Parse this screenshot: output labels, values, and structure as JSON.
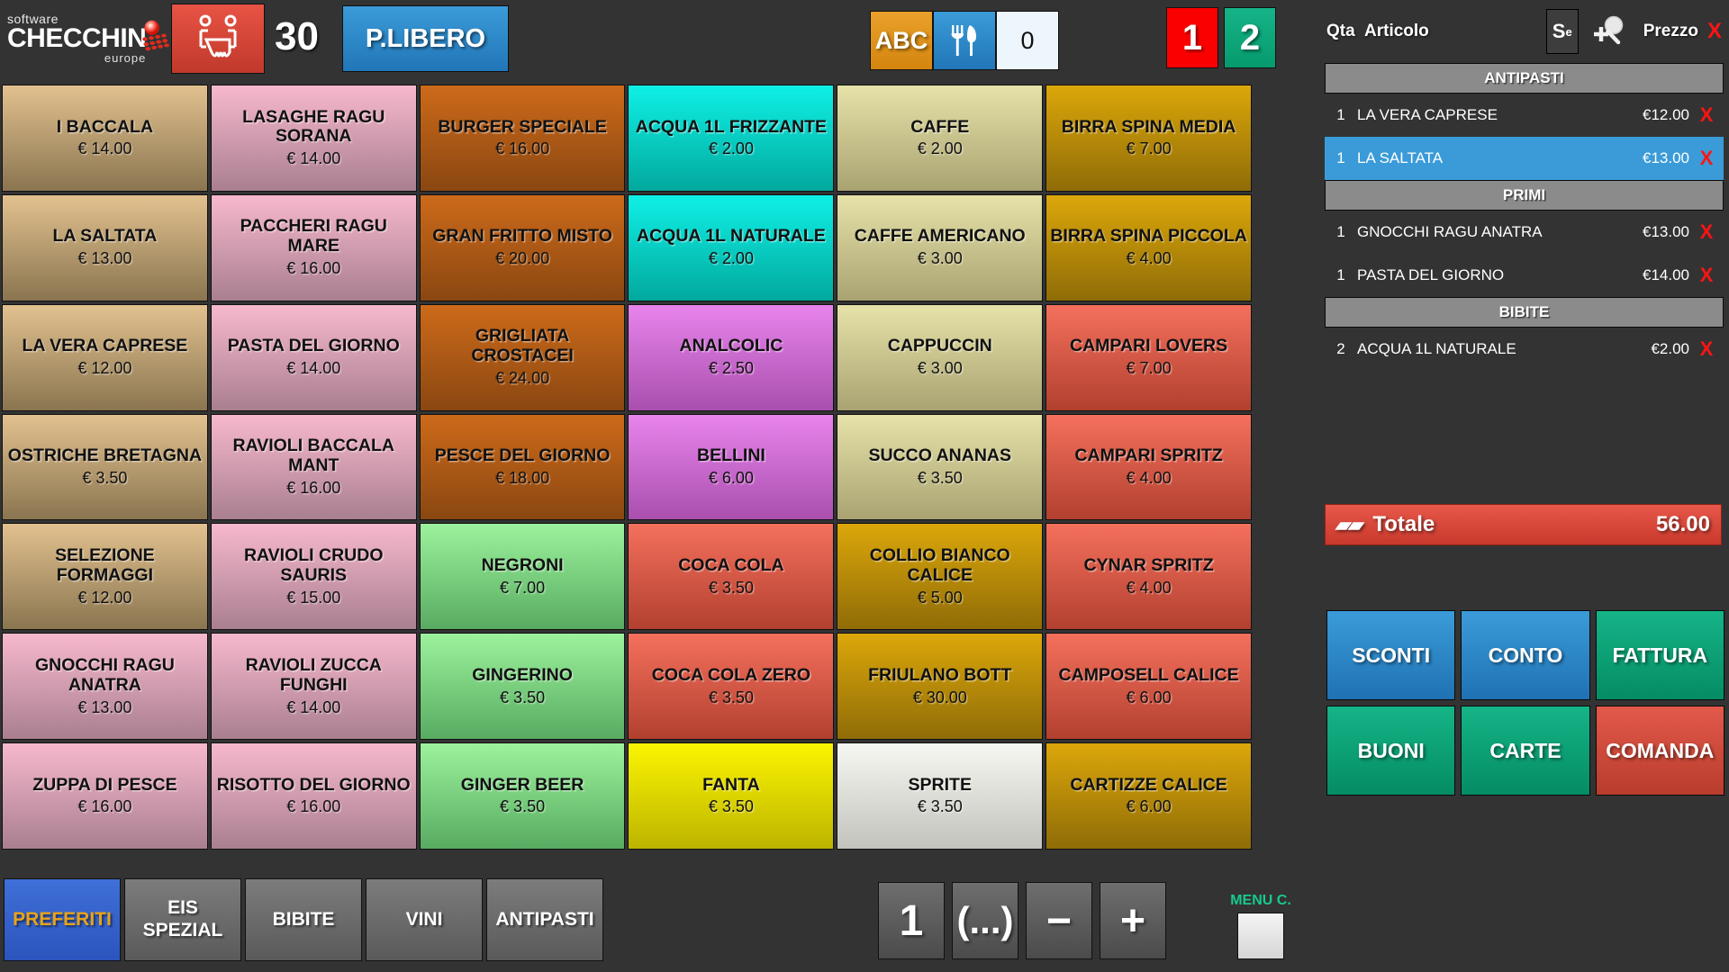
{
  "header": {
    "logo": {
      "software": "software",
      "brand": "CHECCHIN",
      "region": "europe",
      "icon": "checchin-logo-icon"
    },
    "table_icon": "table-seats-icon",
    "table_number": "30",
    "room_label": "P.LIBERO",
    "abc_label": "ABC",
    "cover_icon": "fork-knife-icon",
    "cover_count": "0",
    "qty_buttons": [
      {
        "label": "1",
        "color": "#fb0000"
      },
      {
        "label": "2",
        "color": "#069a6e"
      }
    ]
  },
  "grid": {
    "tiles": [
      {
        "name": "I BACCALA",
        "price": "€ 14.00",
        "c1": "#e2c18f",
        "c2": "#8a7550"
      },
      {
        "name": "LASAGHE RAGU SORANA",
        "price": "€ 14.00",
        "c1": "#f7b8cd",
        "c2": "#a97f90"
      },
      {
        "name": "BURGER SPECIALE",
        "price": "€ 16.00",
        "c1": "#cd6a1a",
        "c2": "#8a4711"
      },
      {
        "name": "ACQUA 1L FRIZZANTE",
        "price": "€ 2.00",
        "c1": "#0ff0e6",
        "c2": "#02a99d"
      },
      {
        "name": "CAFFE",
        "price": "€ 2.00",
        "c1": "#e6e2a8",
        "c2": "#a9a372"
      },
      {
        "name": "BIRRA SPINA MEDIA",
        "price": "€ 7.00",
        "c1": "#dca70a",
        "c2": "#8f6c07"
      },
      {
        "name": "LA SALTATA",
        "price": "€ 13.00",
        "c1": "#e2c18f",
        "c2": "#8a7550"
      },
      {
        "name": "PACCHERI RAGU MARE",
        "price": "€ 16.00",
        "c1": "#f7b8cd",
        "c2": "#a97f90"
      },
      {
        "name": "GRAN FRITTO MISTO",
        "price": "€ 20.00",
        "c1": "#cd6a1a",
        "c2": "#8a4711"
      },
      {
        "name": "ACQUA 1L NATURALE",
        "price": "€ 2.00",
        "c1": "#0ff0e6",
        "c2": "#02a99d"
      },
      {
        "name": "CAFFE AMERICANO",
        "price": "€ 3.00",
        "c1": "#e6e2a8",
        "c2": "#a9a372"
      },
      {
        "name": "BIRRA SPINA PICCOLA",
        "price": "€ 4.00",
        "c1": "#dca70a",
        "c2": "#8f6c07"
      },
      {
        "name": "LA VERA CAPRESE",
        "price": "€ 12.00",
        "c1": "#e2c18f",
        "c2": "#8a7550"
      },
      {
        "name": "PASTA DEL GIORNO",
        "price": "€ 14.00",
        "c1": "#f7b8cd",
        "c2": "#a97f90"
      },
      {
        "name": "GRIGLIATA CROSTACEI",
        "price": "€ 24.00",
        "c1": "#cd6a1a",
        "c2": "#8a4711"
      },
      {
        "name": "ANALCOLIC",
        "price": "€ 2.50",
        "c1": "#e884ec",
        "c2": "#a94fae"
      },
      {
        "name": "CAPPUCCIN",
        "price": "€ 3.00",
        "c1": "#e6e2a8",
        "c2": "#a9a372"
      },
      {
        "name": "CAMPARI LOVERS",
        "price": "€ 7.00",
        "c1": "#f4705c",
        "c2": "#b2402f"
      },
      {
        "name": "OSTRICHE BRETAGNA",
        "price": "€ 3.50",
        "c1": "#e2c18f",
        "c2": "#8a7550"
      },
      {
        "name": "RAVIOLI BACCALA MANT",
        "price": "€ 16.00",
        "c1": "#f7b8cd",
        "c2": "#a97f90"
      },
      {
        "name": "PESCE DEL GIORNO",
        "price": "€ 18.00",
        "c1": "#cd6a1a",
        "c2": "#8a4711"
      },
      {
        "name": "BELLINI",
        "price": "€ 6.00",
        "c1": "#e884ec",
        "c2": "#a94fae"
      },
      {
        "name": "SUCCO ANANAS",
        "price": "€ 3.50",
        "c1": "#e6e2a8",
        "c2": "#a9a372"
      },
      {
        "name": "CAMPARI SPRITZ",
        "price": "€ 4.00",
        "c1": "#f4705c",
        "c2": "#b2402f"
      },
      {
        "name": "SELEZIONE FORMAGGI",
        "price": "€ 12.00",
        "c1": "#e2c18f",
        "c2": "#8a7550"
      },
      {
        "name": "RAVIOLI CRUDO SAURIS",
        "price": "€ 15.00",
        "c1": "#f7b8cd",
        "c2": "#a97f90"
      },
      {
        "name": "NEGRONI",
        "price": "€ 7.00",
        "c1": "#9cf29c",
        "c2": "#58ab61"
      },
      {
        "name": "COCA COLA",
        "price": "€ 3.50",
        "c1": "#f4705c",
        "c2": "#b2402f"
      },
      {
        "name": "COLLIO BIANCO CALICE",
        "price": "€ 5.00",
        "c1": "#dca70a",
        "c2": "#8f6c07"
      },
      {
        "name": "CYNAR SPRITZ",
        "price": "€ 4.00",
        "c1": "#f4705c",
        "c2": "#b2402f"
      },
      {
        "name": "GNOCCHI RAGU ANATRA",
        "price": "€ 13.00",
        "c1": "#f7b8cd",
        "c2": "#a97f90"
      },
      {
        "name": "RAVIOLI ZUCCA FUNGHI",
        "price": "€ 14.00",
        "c1": "#f7b8cd",
        "c2": "#a97f90"
      },
      {
        "name": "GINGERINO",
        "price": "€ 3.50",
        "c1": "#9cf29c",
        "c2": "#58ab61"
      },
      {
        "name": "COCA COLA ZERO",
        "price": "€ 3.50",
        "c1": "#f4705c",
        "c2": "#b2402f"
      },
      {
        "name": "FRIULANO BOTT",
        "price": "€ 30.00",
        "c1": "#dca70a",
        "c2": "#8f6c07"
      },
      {
        "name": "CAMPOSELL CALICE",
        "price": "€ 6.00",
        "c1": "#f4705c",
        "c2": "#b2402f"
      },
      {
        "name": "ZUPPA DI PESCE",
        "price": "€ 16.00",
        "c1": "#f7b8cd",
        "c2": "#a97f90"
      },
      {
        "name": "RISOTTO DEL GIORNO",
        "price": "€ 16.00",
        "c1": "#f7b8cd",
        "c2": "#a97f90"
      },
      {
        "name": "GINGER BEER",
        "price": "€ 3.50",
        "c1": "#9cf29c",
        "c2": "#58ab61"
      },
      {
        "name": "FANTA",
        "price": "€ 3.50",
        "c1": "#fbf500",
        "c2": "#bdb400"
      },
      {
        "name": "SPRITE",
        "price": "€ 3.50",
        "c1": "#f7f7f2",
        "c2": "#c3c3bd"
      },
      {
        "name": "CARTIZZE CALICE",
        "price": "€ 6.00",
        "c1": "#dca70a",
        "c2": "#8f6c07"
      }
    ]
  },
  "category_tabs": [
    {
      "label": "PREFERITI",
      "active": true
    },
    {
      "label": "EIS SPEZIAL",
      "active": false
    },
    {
      "label": "BIBITE",
      "active": false
    },
    {
      "label": "VINI",
      "active": false
    },
    {
      "label": "ANTIPASTI",
      "active": false
    }
  ],
  "numpad": {
    "buttons": [
      {
        "label": "1",
        "name": "quantity-one-button"
      },
      {
        "label": "(...)",
        "name": "variant-button"
      },
      {
        "label": "−",
        "name": "decrement-button"
      },
      {
        "label": "+",
        "name": "increment-button"
      }
    ],
    "menuc_label": "MENU C.",
    "menuc_color": "#18c98c"
  },
  "order": {
    "columns": {
      "qty": "Qta",
      "article": "Articolo",
      "price": "Prezzo",
      "remove": "X"
    },
    "se_button": {
      "main": "S",
      "sup": "e"
    },
    "zoom_icon": "magnifier-plus-icon",
    "rows": [
      {
        "type": "separator",
        "label": "ANTIPASTI"
      },
      {
        "type": "item",
        "qty": "1",
        "name": "LA VERA CAPRESE",
        "price": "€12.00",
        "remove": "X",
        "selected": false
      },
      {
        "type": "item",
        "qty": "1",
        "name": "LA SALTATA",
        "price": "€13.00",
        "remove": "X",
        "selected": true
      },
      {
        "type": "separator",
        "label": "PRIMI"
      },
      {
        "type": "item",
        "qty": "1",
        "name": "GNOCCHI RAGU ANATRA",
        "price": "€13.00",
        "remove": "X",
        "selected": false
      },
      {
        "type": "item",
        "qty": "1",
        "name": "PASTA DEL GIORNO",
        "price": "€14.00",
        "remove": "X",
        "selected": false
      },
      {
        "type": "separator",
        "label": "BIBITE"
      },
      {
        "type": "item",
        "qty": "2",
        "name": "ACQUA 1L NATURALE",
        "price": "€2.00",
        "remove": "X",
        "selected": false
      }
    ],
    "total": {
      "icon": "receipt-icon",
      "label": "Totale",
      "value": "56.00",
      "color": "#c8392c"
    }
  },
  "actions": [
    {
      "label": "SCONTI",
      "style": "act-blue"
    },
    {
      "label": "CONTO",
      "style": "act-blue"
    },
    {
      "label": "FATTURA",
      "style": "act-green"
    },
    {
      "label": "BUONI",
      "style": "act-green"
    },
    {
      "label": "CARTE",
      "style": "act-green"
    },
    {
      "label": "COMANDA",
      "style": "act-red"
    }
  ]
}
